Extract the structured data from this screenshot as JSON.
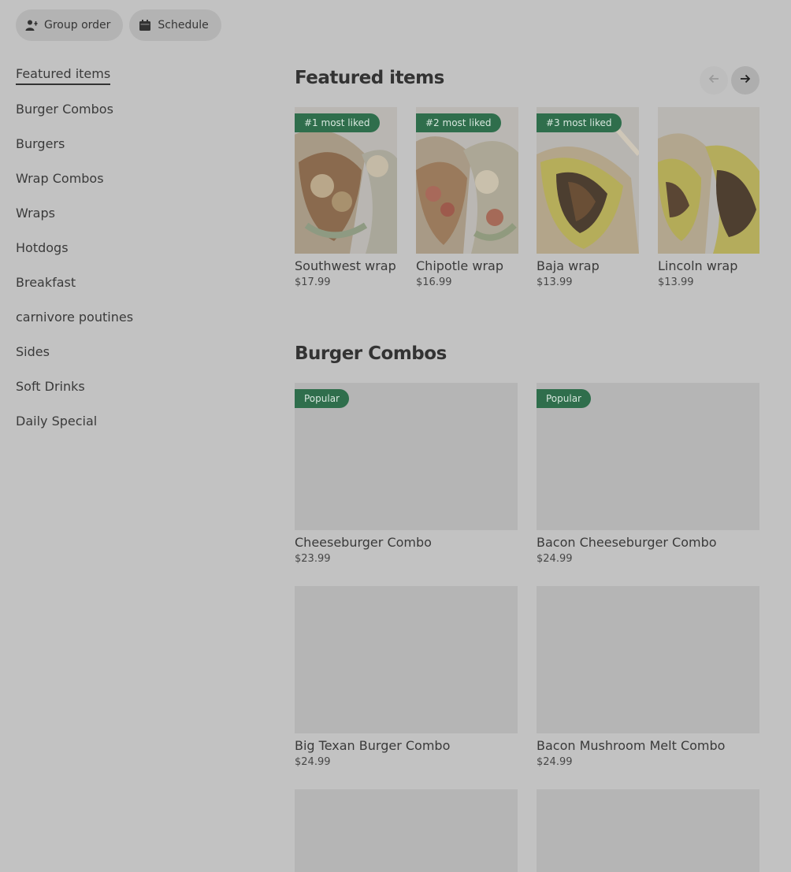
{
  "topbar": {
    "group_order": "Group order",
    "schedule": "Schedule"
  },
  "sidebar": {
    "items": [
      {
        "label": "Featured items",
        "active": true
      },
      {
        "label": "Burger Combos"
      },
      {
        "label": "Burgers"
      },
      {
        "label": "Wrap Combos"
      },
      {
        "label": "Wraps"
      },
      {
        "label": "Hotdogs"
      },
      {
        "label": "Breakfast"
      },
      {
        "label": "carnivore poutines"
      },
      {
        "label": "Sides"
      },
      {
        "label": "Soft Drinks"
      },
      {
        "label": "Daily Special"
      }
    ]
  },
  "featured": {
    "title": "Featured items",
    "prev_icon": "arrow-left-icon",
    "next_icon": "arrow-right-icon",
    "items": [
      {
        "badge": "#1 most liked",
        "name": "Southwest wrap",
        "price": "$17.99",
        "image": "chicken-wrap-image"
      },
      {
        "badge": "#2 most liked",
        "name": "Chipotle wrap",
        "price": "$16.99",
        "image": "chicken-wrap-image"
      },
      {
        "badge": "#3 most liked",
        "name": "Baja wrap",
        "price": "$13.99",
        "image": "egg-wrap-image"
      },
      {
        "name": "Lincoln wrap",
        "price": "$13.99",
        "image": "egg-wrap-image"
      }
    ]
  },
  "burger_combos": {
    "title": "Burger Combos",
    "items": [
      {
        "badge": "Popular",
        "name": "Cheeseburger Combo",
        "price": "$23.99"
      },
      {
        "badge": "Popular",
        "name": "Bacon Cheeseburger Combo",
        "price": "$24.99"
      },
      {
        "name": "Big Texan Burger Combo",
        "price": "$24.99"
      },
      {
        "name": "Bacon Mushroom Melt Combo",
        "price": "$24.99"
      },
      {
        "name": "",
        "price": ""
      },
      {
        "name": "",
        "price": ""
      }
    ]
  },
  "colors": {
    "overlay_bg": "#c2c2c2",
    "badge_green": "#2f6e4c"
  }
}
